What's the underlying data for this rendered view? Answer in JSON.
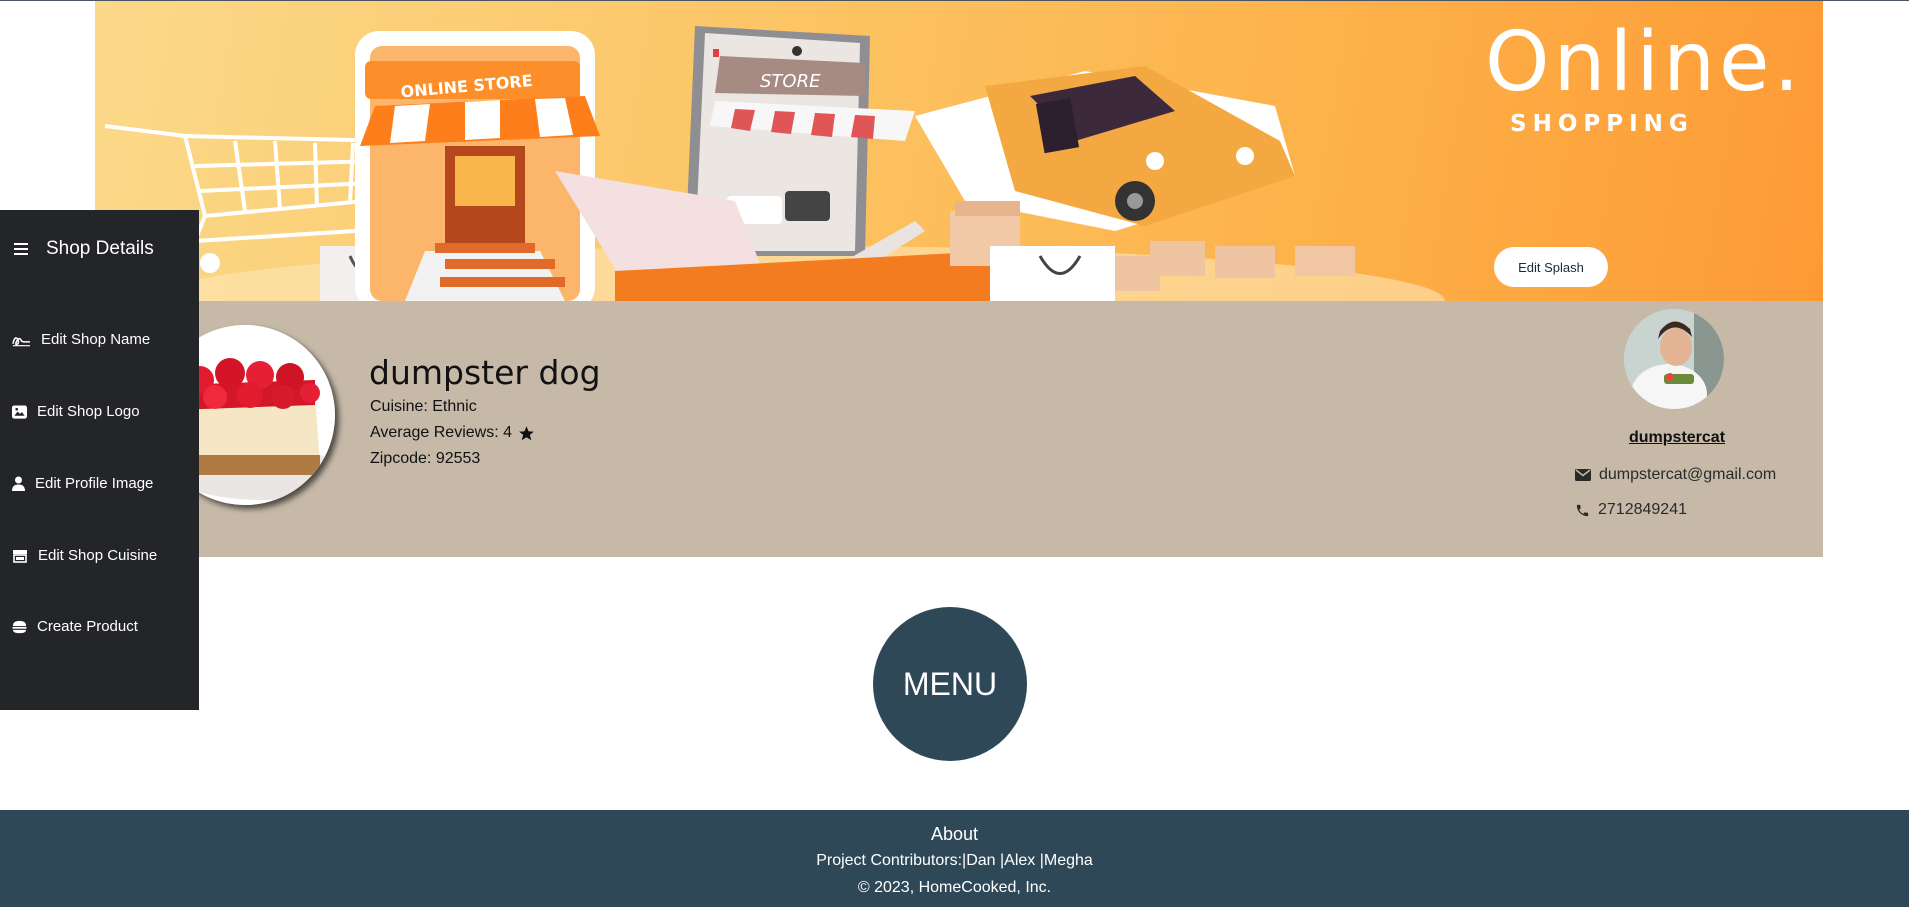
{
  "banner": {
    "title": "Online.",
    "subtitle": "SHOPPING",
    "store_sign": "ONLINE STORE",
    "phone_sign": "STORE",
    "edit_splash_label": "Edit Splash"
  },
  "shop": {
    "name": "dumpster dog",
    "cuisine": "Cuisine: Ethnic",
    "reviews": "Average Reviews: 4",
    "zipcode": "Zipcode: 92553"
  },
  "owner": {
    "username": "dumpstercat",
    "email": "dumpstercat@gmail.com",
    "phone": "2712849241"
  },
  "sidebar": {
    "title": "Shop Details",
    "items": [
      {
        "label": "Edit Shop Name",
        "icon": "signature-icon"
      },
      {
        "label": "Edit Shop Logo",
        "icon": "image-icon"
      },
      {
        "label": "Edit Profile Image",
        "icon": "user-icon"
      },
      {
        "label": "Edit Shop Cuisine",
        "icon": "store-icon"
      },
      {
        "label": "Create Product",
        "icon": "burger-icon"
      }
    ]
  },
  "menu": {
    "label": "MENU"
  },
  "footer": {
    "about": "About",
    "contributors": "Project Contributors:|Dan |Alex |Megha",
    "copyright": "© 2023, HomeCooked, Inc."
  },
  "colors": {
    "sidebar_bg": "#242529",
    "profile_bg": "#c6b9a8",
    "footer_bg": "#2f4858",
    "menu_bg": "#2f4858",
    "banner_orange": "#fd9a34"
  }
}
